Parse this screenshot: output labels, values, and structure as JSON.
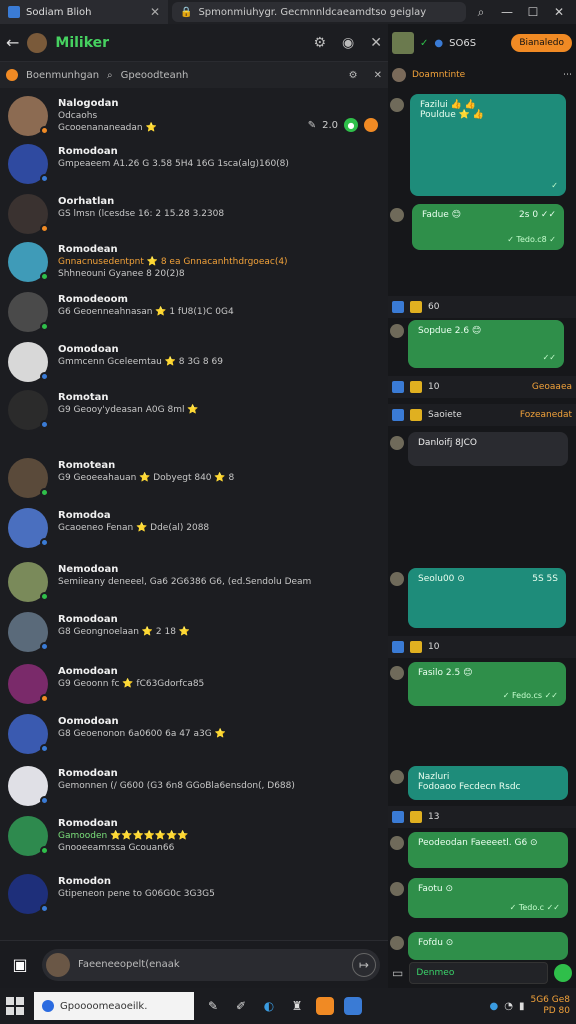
{
  "browser": {
    "tab_title": "Sodiam Blioh",
    "url": "Spmonmiuhygr. Gecmnnldcaeamdtso geiglay"
  },
  "left_header": {
    "app_name": "Miliker"
  },
  "subbar": {
    "title": "Boenmunhgan",
    "search_placeholder": "Gpeoodteanh"
  },
  "chats": [
    {
      "name": "Nalogodan",
      "line1": "Odcaohs",
      "line2": "Gcooenananeadan ⭐",
      "line2_color": "default",
      "meta": "2.0",
      "avatar_color": "#8c6b52",
      "status": "#f08a24"
    },
    {
      "name": "Romodoan",
      "line1": "Gmpeaeem A1.26 G 3.58 5H4 16G 1sca(alg)160(8)",
      "line1_color": "default",
      "avatar_color": "#2f4aa0",
      "status": "#3a7bd5"
    },
    {
      "name": "Oorhatlan",
      "line1": "GS lmsn (lcesdse 16: 2 15.28 3.2308",
      "line1_color": "default",
      "avatar_color": "#3a3230",
      "status": "#f08a24"
    },
    {
      "name": "Romodean",
      "line1": "Gnnacnusedentpnt ⭐ 8 ea Gnnacanhthdrgoeac(4)",
      "line1_color": "orange",
      "line2": "Shhneouni Gyanee 8 20(2)8",
      "line2_color": "default",
      "avatar_color": "#3f9bb8",
      "status": "#2fbf4a"
    },
    {
      "name": "Romodeoom",
      "line1": "G6 Geoenneahnasan ⭐ 1 fU8(1)C 0G4",
      "line1_color": "default",
      "avatar_color": "#4a4a4a",
      "status": "#2fbf4a"
    },
    {
      "name": "Oomodoan",
      "line1": "Gmmcenn Gceleemtau ⭐ 8 3G 8 69",
      "line1_color": "default",
      "avatar_color": "#d8d8d8",
      "status": "#3a7bd5"
    },
    {
      "name": "Romotan",
      "line1": "G9 Geooy'ydeasan A0G 8ml ⭐",
      "line1_color": "default",
      "avatar_color": "#2b2b2b",
      "status": "#3a7bd5"
    },
    {
      "name": "Romotean",
      "line1": "G9 Geoeeahauan ⭐ Dobyegt 840 ⭐ 8",
      "line1_color": "default",
      "avatar_color": "#5a4a3a",
      "status": "#2fbf4a"
    },
    {
      "name": "Romodoa",
      "line1": "Gcaoeneo Fenan ⭐ Dde(al) 2088",
      "line1_color": "default",
      "avatar_color": "#4a6fbf",
      "status": "#3a7bd5"
    },
    {
      "name": "Nemodoan",
      "line1": "Semiieany deneeel, Ga6 2G6386 G6, (ed.Sendolu Deam",
      "line1_color": "default",
      "avatar_color": "#7a8a5a",
      "status": "#2fbf4a"
    },
    {
      "name": "Romodoan",
      "line1": "G8 Geongnoelaan ⭐ 2 18 ⭐",
      "line1_color": "default",
      "avatar_color": "#5a6a7a",
      "status": "#3a7bd5"
    },
    {
      "name": "Aomodoan",
      "line1": "G9 Geoonn fc ⭐ fC63Gdorfca85",
      "line1_color": "default",
      "avatar_color": "#7a2a6a",
      "status": "#f08a24"
    },
    {
      "name": "Oomodoan",
      "line1": "G8 Geoenonon 6a0600 6a 47 a3G ⭐",
      "line1_color": "default",
      "avatar_color": "#3a5ab0",
      "status": "#3a7bd5"
    },
    {
      "name": "Romodoan",
      "line1": "Gemonnen (/ G600 (G3 6n8 GGoBla6ensdon(, D688)",
      "line1_color": "default",
      "avatar_color": "#e0e0e6",
      "status": "#3a7bd5"
    },
    {
      "name": "Romodoan",
      "line1": "Gamooden ⭐⭐⭐⭐⭐⭐⭐",
      "line1_color": "green",
      "line2": "Gnooeeamrssa Gcouan66",
      "line2_color": "default",
      "avatar_color": "#2e8a4e",
      "status": "#2fbf4a"
    },
    {
      "name": "Romodon",
      "line1": "Gtipeneon pene to G06G0c 3G3G5",
      "line1_color": "default",
      "avatar_color": "#1e2f7a",
      "status": "#3a7bd5"
    }
  ],
  "composer": {
    "placeholder": "Faeeneeopelt(enaak"
  },
  "right": {
    "top_pill": "Bianaledo",
    "top_label": "SO6S",
    "sub_title": "Doamntinte",
    "bubbles": [
      {
        "text": "Fazilui 👍 👍\nPouldue ⭐ 👍",
        "color": "teal",
        "tick": "✓"
      },
      {
        "text": "Fadue 😊",
        "color": "green",
        "tick": "✓ Tedo.c8 ✓",
        "right": "2s 0 ✓✓"
      },
      {
        "text": "Sopdue 2.6 😊",
        "color": "green",
        "tick": "✓✓"
      },
      {
        "text": "Danloifj 8JCO",
        "color": "grey",
        "tick": ""
      },
      {
        "text": "Seolu00 ⊙",
        "color": "teal",
        "tick": "",
        "right": "5S 5S"
      },
      {
        "text": "Fasilo 2.5 😊",
        "color": "green",
        "tick": "✓ Fedo.cs ✓✓"
      },
      {
        "text": "Nazluri\nFodoaoo Fecdecn Rsdc",
        "color": "teal",
        "tick": ""
      },
      {
        "text": "Peodeodan Faeeeetl. G6 ⊙",
        "color": "green",
        "tick": ""
      },
      {
        "text": "Faotu ⊙",
        "color": "green",
        "tick": "✓ Tedo.c ✓✓"
      },
      {
        "text": "Fofdu ⊙",
        "color": "green",
        "tick": ""
      }
    ],
    "strips": [
      {
        "text": "60",
        "top": ""
      },
      {
        "text": "10",
        "right": "Geoaaea"
      },
      {
        "text": "Saoiete",
        "right": "Fozeanedat"
      },
      {
        "text": "10"
      },
      {
        "text": "13"
      }
    ],
    "input_placeholder": "Denmeo"
  },
  "taskbar": {
    "search_text": "Gpoooomeaoeilk.",
    "clock_time": "5G6 Ge8",
    "clock_date": "PD 80"
  },
  "colors": {
    "accent_green": "#2fbf4a",
    "accent_orange": "#f08a24",
    "teal_bubble": "#1e8c7a",
    "green_bubble": "#2f8f4a"
  }
}
